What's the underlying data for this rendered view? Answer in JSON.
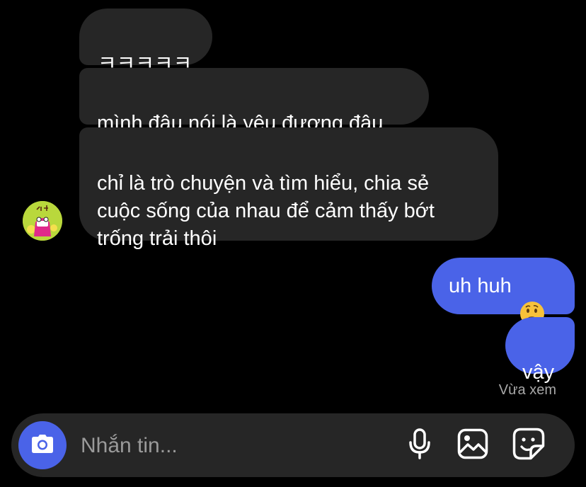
{
  "conversation": {
    "messages": [
      {
        "sender": "other",
        "text": "ㅋㅋㅋㅋㅋ"
      },
      {
        "sender": "other",
        "text": "mình đâu nói là yêu đương đâu"
      },
      {
        "sender": "other",
        "text": "chỉ là trò chuyện và tìm hiểu, chia sẻ\ncuộc sống của nhau để cảm thấy bớt\ntrống trải thôi"
      },
      {
        "sender": "me",
        "text": "uh huh",
        "emoji": "thinking-face"
      },
      {
        "sender": "me",
        "text": "vậy"
      }
    ],
    "seen_status": "Vừa xem"
  },
  "composer": {
    "placeholder": "Nhắn tin...",
    "icons": {
      "camera": "camera-icon",
      "mic": "microphone-icon",
      "gallery": "image-icon",
      "sticker": "sticker-icon"
    }
  },
  "colors": {
    "background": "#000000",
    "incoming_bubble": "#262626",
    "outgoing_bubble": "#4a63e8",
    "composer": "#262626",
    "muted_text": "#a8a8a8"
  }
}
